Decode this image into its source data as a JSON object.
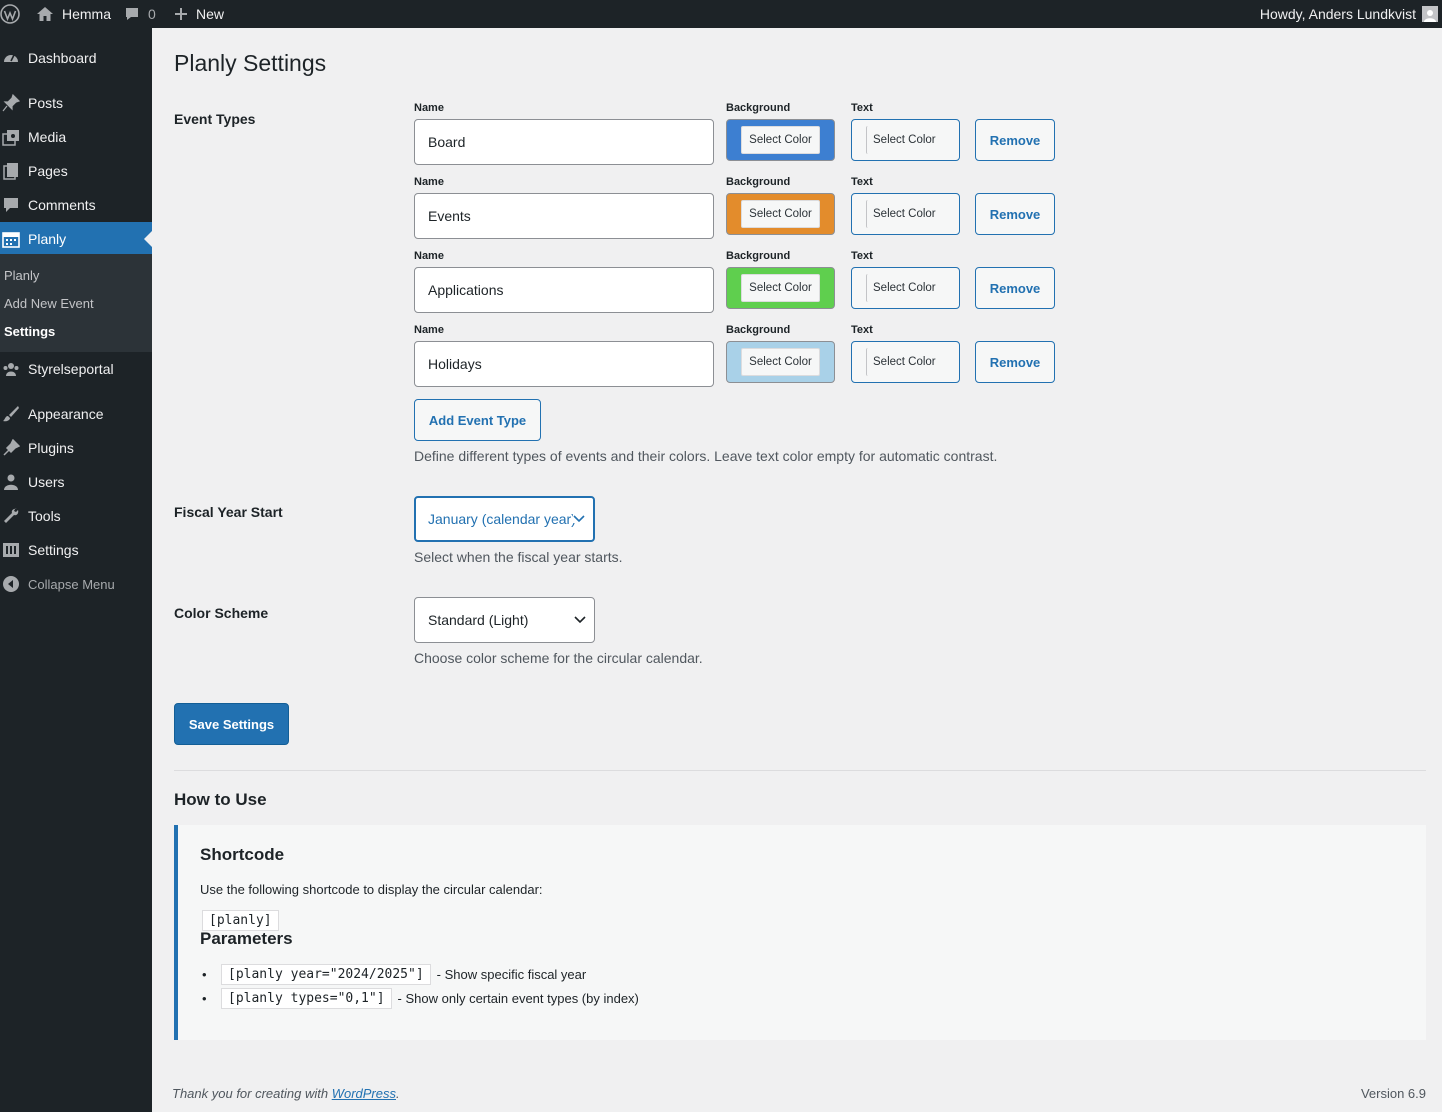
{
  "adminbar": {
    "site_name": "Hemma",
    "comments_count": "0",
    "new_label": "New",
    "howdy": "Howdy, Anders Lundkvist"
  },
  "sidebar": {
    "items": [
      {
        "label": "Dashboard",
        "icon": "dashboard-icon"
      },
      {
        "label": "Posts",
        "icon": "pin-icon"
      },
      {
        "label": "Media",
        "icon": "media-icon"
      },
      {
        "label": "Pages",
        "icon": "pages-icon"
      },
      {
        "label": "Comments",
        "icon": "comment-icon"
      },
      {
        "label": "Planly",
        "icon": "calendar-icon"
      },
      {
        "label": "Styrelseportal",
        "icon": "groups-icon"
      },
      {
        "label": "Appearance",
        "icon": "brush-icon"
      },
      {
        "label": "Plugins",
        "icon": "plugin-icon"
      },
      {
        "label": "Users",
        "icon": "user-icon"
      },
      {
        "label": "Tools",
        "icon": "wrench-icon"
      },
      {
        "label": "Settings",
        "icon": "settings-icon"
      },
      {
        "label": "Collapse Menu",
        "icon": "collapse-icon"
      }
    ],
    "submenu": [
      "Planly",
      "Add New Event",
      "Settings"
    ]
  },
  "page": {
    "title": "Planly Settings",
    "event_types_label": "Event Types",
    "name_caption": "Name",
    "background_caption": "Background",
    "text_caption": "Text",
    "select_color": "Select Color",
    "remove": "Remove",
    "event_types": [
      {
        "name": "Board",
        "bg": "#3d7fd1"
      },
      {
        "name": "Events",
        "bg": "#e38c2c"
      },
      {
        "name": "Applications",
        "bg": "#5fcf4e"
      },
      {
        "name": "Holidays",
        "bg": "#a9d1e8"
      }
    ],
    "add_event_type": "Add Event Type",
    "event_types_desc": "Define different types of events and their colors. Leave text color empty for automatic contrast.",
    "fiscal_label": "Fiscal Year Start",
    "fiscal_value": "January (calendar year)",
    "fiscal_desc": "Select when the fiscal year starts.",
    "scheme_label": "Color Scheme",
    "scheme_value": "Standard (Light)",
    "scheme_desc": "Choose color scheme for the circular calendar.",
    "save": "Save Settings"
  },
  "howto": {
    "title": "How to Use",
    "shortcode_title": "Shortcode",
    "shortcode_desc": "Use the following shortcode to display the circular calendar:",
    "shortcode": "[planly]",
    "params_title": "Parameters",
    "params": [
      {
        "code": "[planly year=\"2024/2025\"]",
        "desc": "- Show specific fiscal year"
      },
      {
        "code": "[planly types=\"0,1\"]",
        "desc": "- Show only certain event types (by index)"
      }
    ]
  },
  "footer": {
    "thanks_prefix": "Thank you for creating with ",
    "link": "WordPress",
    "suffix": ".",
    "version": "Version 6.9"
  }
}
